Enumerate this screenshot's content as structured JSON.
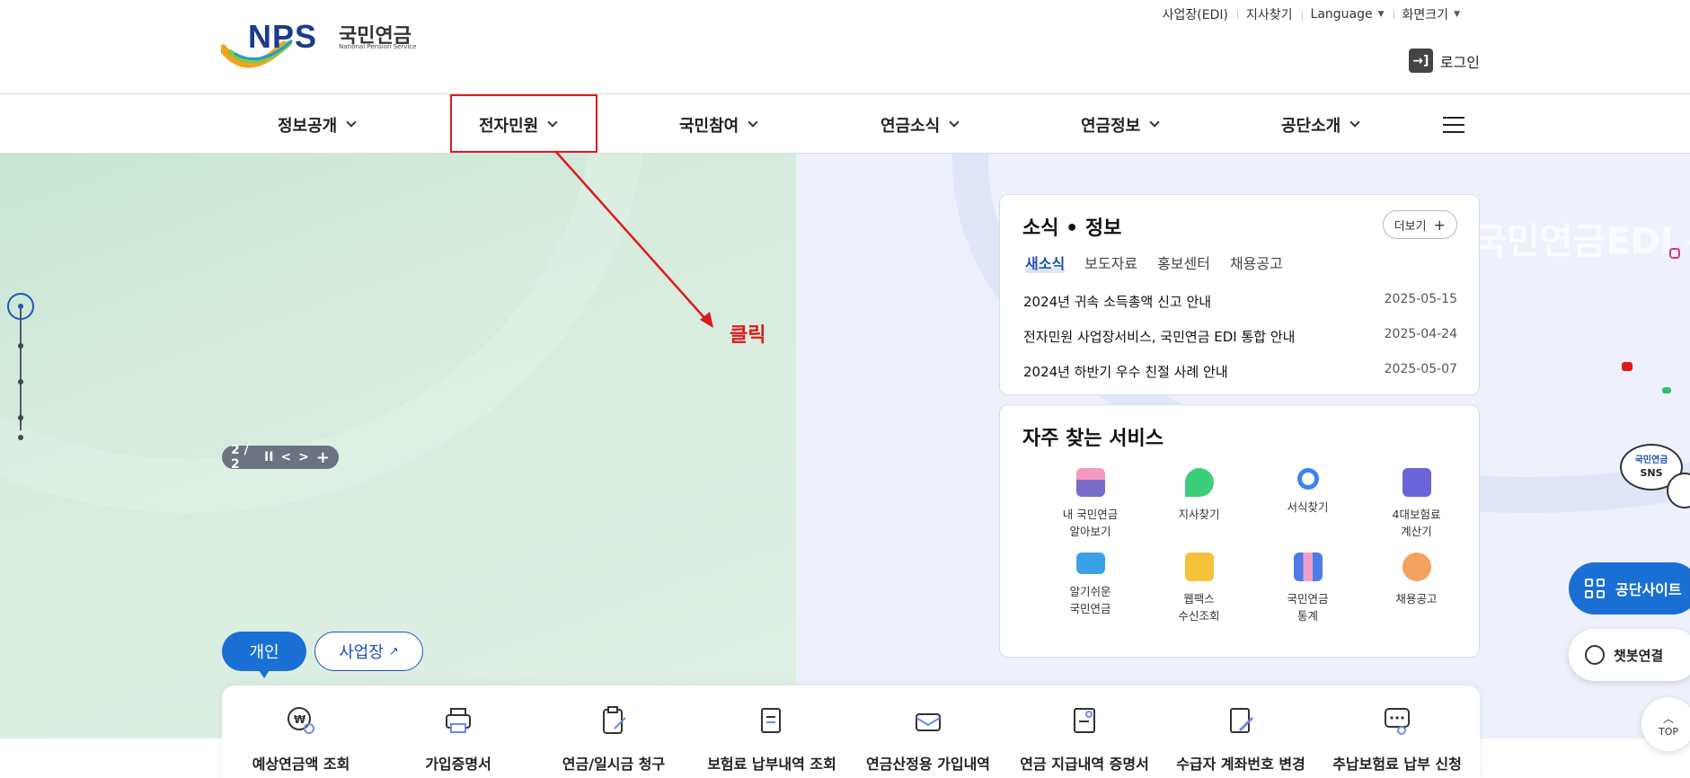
{
  "header": {
    "logo_mark": "NPS",
    "logo_kr": "국민연금",
    "logo_en": "National Pension Service",
    "utility": [
      "사업장(EDI)",
      "지사찾기",
      "Language",
      "화면크기"
    ],
    "login": "로그인"
  },
  "gnb": {
    "items": [
      "정보공개",
      "전자민원",
      "국민참여",
      "연금소식",
      "연금정보",
      "공단소개"
    ],
    "highlighted": "전자민원"
  },
  "annotation": {
    "label": "클릭",
    "color": "#e0191b"
  },
  "hero": {
    "pager": "2 / 2",
    "controls": [
      "II",
      "<",
      ">",
      "+"
    ]
  },
  "news": {
    "title": "소식 • 정보",
    "more": "더보기",
    "tabs": [
      "새소식",
      "보도자료",
      "홍보센터",
      "채용공고"
    ],
    "items": [
      {
        "title": "2024년 귀속 소득총액 신고 안내",
        "date": "2025-05-15"
      },
      {
        "title": "전자민원 사업장서비스, 국민연금 EDI 통합 안내",
        "date": "2025-04-24"
      },
      {
        "title": "2024년 하반기 우수 친절 사례 안내",
        "date": "2025-05-07"
      }
    ]
  },
  "services": {
    "title": "자주 찾는 서비스",
    "items": [
      {
        "l1": "내 국민연금",
        "l2": "알아보기",
        "icon": "gift-icon"
      },
      {
        "l1": "지사찾기",
        "l2": "",
        "icon": "map-pin-icon"
      },
      {
        "l1": "서식찾기",
        "l2": "",
        "icon": "magnifier-icon"
      },
      {
        "l1": "4대보험료",
        "l2": "계산기",
        "icon": "calculator-icon"
      },
      {
        "l1": "알기쉬운",
        "l2": "국민연금",
        "icon": "monitor-icon"
      },
      {
        "l1": "웹팩스",
        "l2": "수신조회",
        "icon": "fax-icon"
      },
      {
        "l1": "국민연금",
        "l2": "통계",
        "icon": "bar-chart-icon"
      },
      {
        "l1": "채용공고",
        "l2": "",
        "icon": "speech-bubble-icon"
      }
    ]
  },
  "tabs": {
    "personal": "개인",
    "business": "사업장"
  },
  "quick": [
    "예상연금액 조회",
    "가입증명서",
    "연금/일시금 청구",
    "보험료 납부내역 조회",
    "연금산정용 가입내역",
    "연금 지급내역 증명서",
    "수급자 계좌번호 변경",
    "추납보험료 납부 신청"
  ],
  "floating": {
    "sns_1": "국민연금",
    "sns_2": "SNS",
    "site": "공단사이트",
    "chatbot": "챗봇연결",
    "top": "TOP"
  },
  "colors": {
    "brand": "#1a6fd4",
    "navy": "#1e4fb4",
    "highlight": "#e0191b"
  }
}
